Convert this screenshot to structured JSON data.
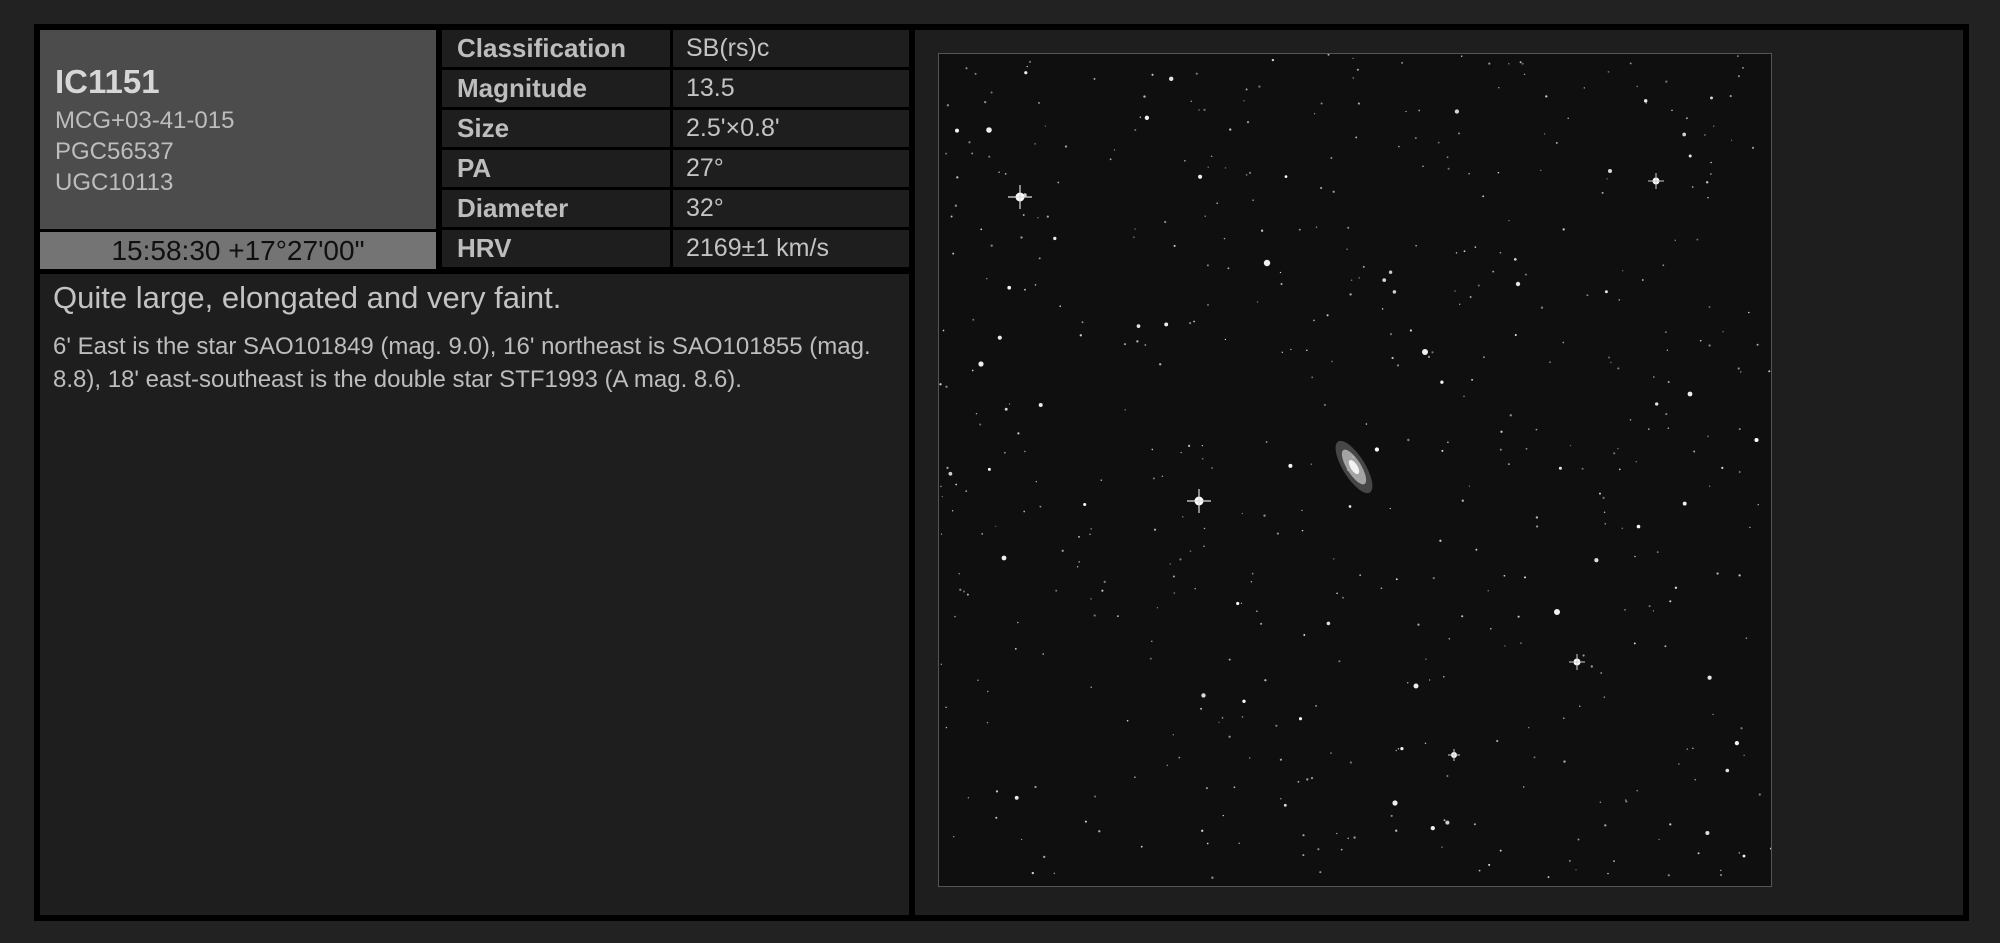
{
  "object": {
    "name": "IC1151",
    "aliases": [
      "MCG+03-41-015",
      "PGC56537",
      "UGC10113"
    ],
    "coordinates": "15:58:30 +17°27'00\""
  },
  "properties": [
    {
      "label": "Classification",
      "value": "SB(rs)c"
    },
    {
      "label": "Magnitude",
      "value": "13.5"
    },
    {
      "label": "Size",
      "value": "2.5'×0.8'"
    },
    {
      "label": "PA",
      "value": "27°"
    },
    {
      "label": "Diameter",
      "value": "32°"
    },
    {
      "label": "HRV",
      "value": "2169±1 km/s"
    }
  ],
  "description": {
    "title": "Quite large, elongated and very faint.",
    "body": "6' East is the star SAO101849 (mag. 9.0), 16' northeast is SAO101855 (mag. 8.8), 18' east-southeast is the double star STF1993 (A mag. 8.6)."
  },
  "colors": {
    "page_background": "#222222",
    "frame": "#000000",
    "name_box": "#4c4c4c",
    "coords_box": "#747474",
    "cell_background": "#1e1e1e",
    "sky": "#0f0f0f"
  }
}
